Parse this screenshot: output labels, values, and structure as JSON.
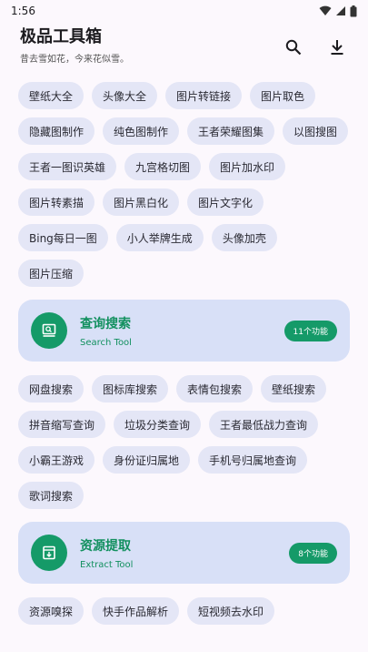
{
  "status_bar": {
    "time": "1:56"
  },
  "header": {
    "title": "极品工具箱",
    "subtitle": "昔去雪如花，今来花似雪。"
  },
  "icons": {
    "search": "search-icon",
    "download": "download-icon",
    "wifi": "wifi-icon",
    "signal": "signal-icon",
    "battery": "battery-icon"
  },
  "image_tools": [
    "壁纸大全",
    "头像大全",
    "图片转链接",
    "图片取色",
    "隐藏图制作",
    "纯色图制作",
    "王者荣耀图集",
    "以图搜图",
    "王者一图识英雄",
    "九宫格切图",
    "图片加水印",
    "图片转素描",
    "图片黑白化",
    "图片文字化",
    "Bing每日一图",
    "小人举牌生成",
    "头像加壳",
    "图片压缩"
  ],
  "search_section": {
    "title": "查询搜索",
    "subtitle": "Search Tool",
    "badge": "11个功能",
    "items": [
      "网盘搜索",
      "图标库搜索",
      "表情包搜索",
      "壁纸搜索",
      "拼音缩写查询",
      "垃圾分类查询",
      "王者最低战力查询",
      "小霸王游戏",
      "身份证归属地",
      "手机号归属地查询",
      "歌词搜索"
    ]
  },
  "resource_section": {
    "title": "资源提取",
    "subtitle": "Extract Tool",
    "badge": "8个功能",
    "items": [
      "资源嗅探",
      "快手作品解析",
      "短视频去水印"
    ]
  },
  "colors": {
    "accent": "#159a68",
    "chip_bg": "#e4e6f6",
    "card_bg": "#d8e0f7",
    "background": "#fcf8fd"
  }
}
